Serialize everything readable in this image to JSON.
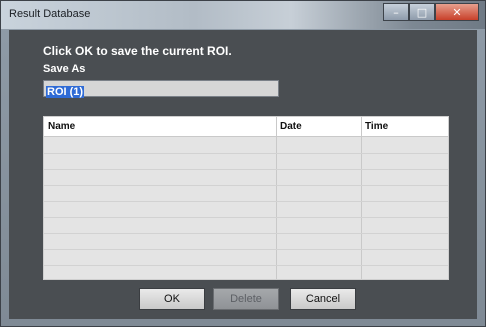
{
  "window": {
    "title": "Result Database",
    "minimize": "–",
    "maximize": "□",
    "close": "✕"
  },
  "dialog": {
    "instruction": "Click OK to save the current ROI.",
    "save_as_label": "Save As",
    "save_as_value": "ROI (1)"
  },
  "table": {
    "columns": [
      "Name",
      "Date",
      "Time"
    ],
    "rows": []
  },
  "buttons": {
    "ok": "OK",
    "delete": "Delete",
    "cancel": "Cancel"
  }
}
